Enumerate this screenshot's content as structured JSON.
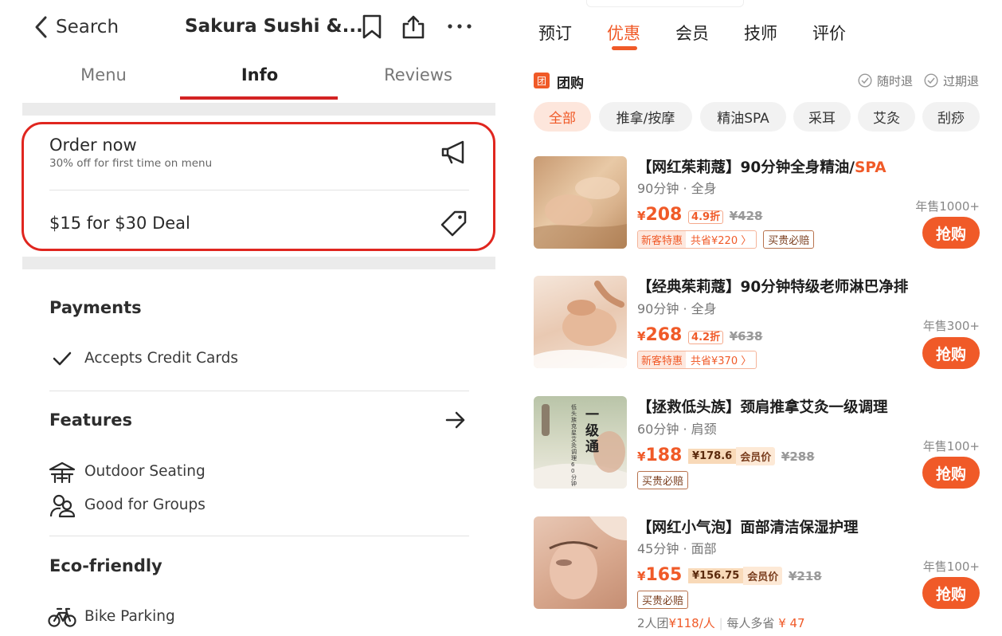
{
  "left": {
    "nav": {
      "back_label": "Search",
      "title": "Sakura Sushi &..."
    },
    "tabs": [
      "Menu",
      "Info",
      "Reviews"
    ],
    "offers": [
      {
        "title": "Order now",
        "subtitle": "30% off for first time on menu",
        "icon": "megaphone-icon"
      },
      {
        "title": "$15 for $30 Deal",
        "icon": "tag-icon"
      }
    ],
    "payments": {
      "heading": "Payments",
      "items": [
        "Accepts Credit Cards"
      ]
    },
    "features": {
      "heading": "Features",
      "items": [
        "Outdoor Seating",
        "Good for Groups"
      ]
    },
    "eco": {
      "heading": "Eco-friendly",
      "items": [
        "Bike Parking"
      ]
    },
    "accent": "#d32323"
  },
  "right": {
    "tabs": [
      "预订",
      "优惠",
      "会员",
      "技师",
      "评价"
    ],
    "section": {
      "badge": "团",
      "title": "团购",
      "flags": [
        "随时退",
        "过期退"
      ]
    },
    "chips": [
      "全部",
      "推拿/按摩",
      "精油SPA",
      "采耳",
      "艾灸",
      "刮痧"
    ],
    "items": [
      {
        "title_main": "【网红茱莉蔻】90分钟全身精油/",
        "title_hl": "SPA",
        "sub": "90分钟 · 全身",
        "price_sym": "¥",
        "price": "208",
        "discount": "4.9折",
        "orig": "¥428",
        "tag_new": "新客特惠",
        "tag_save": "共省¥220 〉",
        "tag_buy": "买贵必赔",
        "sold": "年售1000+",
        "buy_label": "抢购"
      },
      {
        "title_main": "【经典茱莉蔻】90分钟特级老师淋巴净排",
        "sub": "90分钟 · 全身",
        "price_sym": "¥",
        "price": "268",
        "discount": "4.2折",
        "orig": "¥638",
        "tag_new": "新客特惠",
        "tag_save": "共省¥370 〉",
        "sold": "年售300+",
        "buy_label": "抢购"
      },
      {
        "title_main": "【拯救低头族】颈肩推拿艾灸一级调理",
        "sub": "60分钟 · 肩颈",
        "price_sym": "¥",
        "price": "188",
        "member_price": "¥178.6",
        "member_label": "会员价",
        "orig": "¥288",
        "tag_buy": "买贵必赔",
        "sold": "年售100+",
        "buy_label": "抢购",
        "thumb_text": [
          "一",
          "级",
          "通"
        ],
        "thumb_small": "低头族克星  艾灸调理60分钟"
      },
      {
        "title_main": "【网红小气泡】面部清洁保湿护理",
        "sub": "45分钟 · 面部",
        "price_sym": "¥",
        "price": "165",
        "member_price": "¥156.75",
        "member_label": "会员价",
        "orig": "¥218",
        "tag_buy": "买贵必赔",
        "sold": "年售100+",
        "buy_label": "抢购",
        "group_text_a": "2人团",
        "group_price": "¥118/人",
        "group_text_b": "每人多省",
        "group_save": "¥ 47"
      }
    ],
    "accent": "#f05a28"
  }
}
